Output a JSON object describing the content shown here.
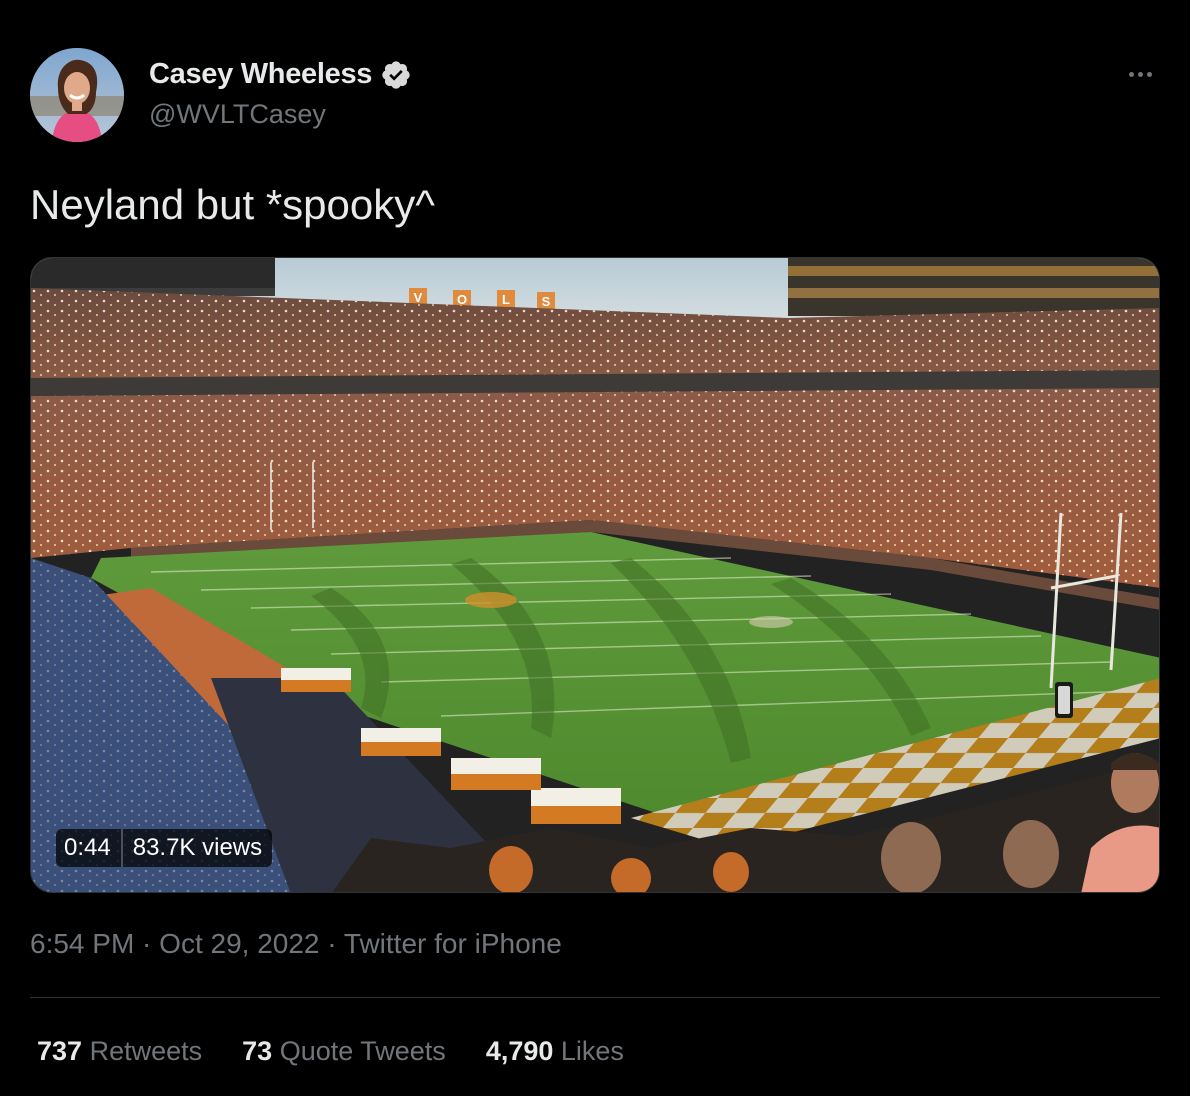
{
  "author": {
    "display_name": "Casey Wheeless",
    "handle": "@WVLTCasey",
    "verified_icon": "verified-badge-icon",
    "avatar_icon": "profile-avatar"
  },
  "tweet": {
    "text": "Neyland but *spooky^"
  },
  "media": {
    "type": "video",
    "duration": "0:44",
    "views": "83.7K views",
    "sign_letters": [
      "V",
      "O",
      "L",
      "S"
    ]
  },
  "meta": {
    "time": "6:54 PM",
    "separator": " · ",
    "date": "Oct 29, 2022",
    "source": "Twitter for iPhone"
  },
  "stats": {
    "retweets_count": "737",
    "retweets_label": "Retweets",
    "quotes_count": "73",
    "quotes_label": "Quote Tweets",
    "likes_count": "4,790",
    "likes_label": "Likes"
  },
  "colors": {
    "background": "#000000",
    "primary_text": "#e7e9ea",
    "secondary_text": "#71767b",
    "divider": "#2f3336",
    "tennessee_orange": "#ff8200"
  }
}
